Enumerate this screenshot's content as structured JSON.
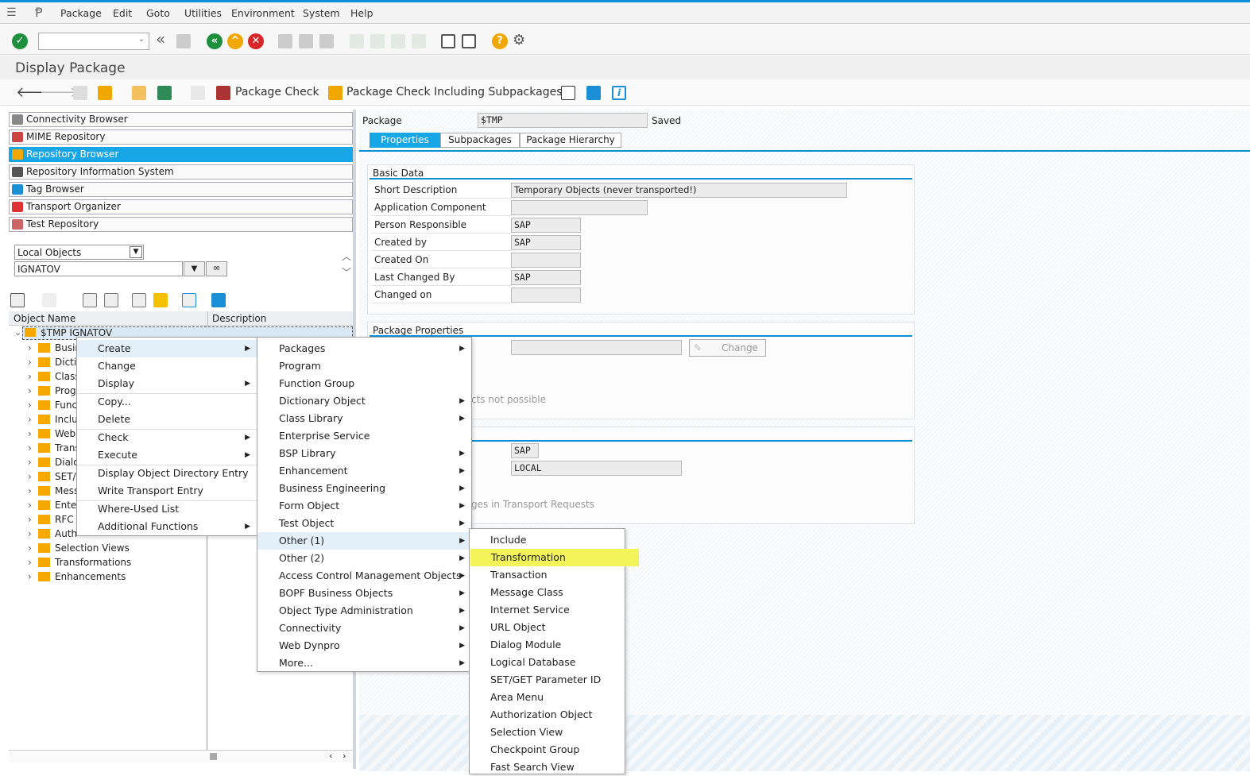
{
  "menubar": {
    "items": [
      "Package",
      "Edit",
      "Goto",
      "Utilities",
      "Environment",
      "System",
      "Help"
    ]
  },
  "header": {
    "title": "Display Package"
  },
  "app_toolbar": {
    "package_check": "Package Check",
    "package_check_sub": "Package Check Including Subpackages"
  },
  "navigator": {
    "buttons": [
      "Connectivity Browser",
      "MIME Repository",
      "Repository Browser",
      "Repository Information System",
      "Tag Browser",
      "Transport Organizer",
      "Test Repository"
    ],
    "selected": 2
  },
  "object_select": {
    "type": "Local Objects",
    "value": "IGNATOV"
  },
  "tree": {
    "col_name": "Object Name",
    "col_desc": "Description",
    "root": "$TMP IGNATOV",
    "items": [
      "Busin",
      "Dictio",
      "Class",
      "Progr",
      "Funct",
      "Inclu",
      "Web",
      "Trans",
      "Dialo",
      "SET/",
      "Mess",
      "Enter",
      "RFC S",
      "Auth",
      "Selection Views",
      "Transformations",
      "Enhancements"
    ]
  },
  "package": {
    "label": "Package",
    "value": "$TMP",
    "status": "Saved"
  },
  "tabs": [
    "Properties",
    "Subpackages",
    "Package Hierarchy"
  ],
  "basic_data": {
    "title": "Basic Data",
    "rows": [
      {
        "label": "Short Description",
        "value": "Temporary Objects (never transported!)"
      },
      {
        "label": "Application Component",
        "value": ""
      },
      {
        "label": "Person Responsible",
        "value": "SAP"
      },
      {
        "label": "Created by",
        "value": "SAP"
      },
      {
        "label": "Created On",
        "value": ""
      },
      {
        "label": "Last Changed By",
        "value": "SAP"
      },
      {
        "label": "Changed on",
        "value": ""
      }
    ]
  },
  "package_properties": {
    "title": "Package Properties",
    "change_button": "Change",
    "partial_text": "cts not possible"
  },
  "transport": {
    "software_component": "SAP",
    "transport_layer": "LOCAL",
    "partial_text": "ges in Transport Requests"
  },
  "context_menu": {
    "items": [
      {
        "label": "Create",
        "sub": true,
        "hl": true
      },
      {
        "label": "Change"
      },
      {
        "label": "Display",
        "sub": true
      },
      {
        "label": "Copy...",
        "sep": true
      },
      {
        "label": "Delete"
      },
      {
        "label": "Check",
        "sub": true,
        "sep": true
      },
      {
        "label": "Execute",
        "sub": true
      },
      {
        "label": "Display Object Directory Entry",
        "sep": true
      },
      {
        "label": "Write Transport Entry"
      },
      {
        "label": "Where-Used List",
        "sep": true
      },
      {
        "label": "Additional Functions",
        "sub": true
      }
    ]
  },
  "create_menu": {
    "items": [
      {
        "label": "Packages",
        "sub": true
      },
      {
        "label": "Program"
      },
      {
        "label": "Function Group"
      },
      {
        "label": "Dictionary Object",
        "sub": true
      },
      {
        "label": "Class Library",
        "sub": true
      },
      {
        "label": "Enterprise Service"
      },
      {
        "label": "BSP Library",
        "sub": true
      },
      {
        "label": "Enhancement",
        "sub": true
      },
      {
        "label": "Business Engineering",
        "sub": true
      },
      {
        "label": "Form Object",
        "sub": true
      },
      {
        "label": "Test Object",
        "sub": true
      },
      {
        "label": "Other (1)",
        "sub": true,
        "hl": true
      },
      {
        "label": "Other (2)",
        "sub": true
      },
      {
        "label": "Access Control Management Objects",
        "sub": true
      },
      {
        "label": "BOPF Business Objects",
        "sub": true
      },
      {
        "label": "Object Type Administration",
        "sub": true
      },
      {
        "label": "Connectivity",
        "sub": true
      },
      {
        "label": "Web Dynpro",
        "sub": true
      },
      {
        "label": "More...",
        "sub": true
      }
    ]
  },
  "other1_menu": {
    "items": [
      {
        "label": "Include"
      },
      {
        "label": "Transformation",
        "yl": true
      },
      {
        "label": "Transaction"
      },
      {
        "label": "Message Class"
      },
      {
        "label": "Internet Service"
      },
      {
        "label": "URL Object"
      },
      {
        "label": "Dialog Module"
      },
      {
        "label": "Logical Database"
      },
      {
        "label": "SET/GET Parameter ID"
      },
      {
        "label": "Area Menu"
      },
      {
        "label": "Authorization Object"
      },
      {
        "label": "Selection View"
      },
      {
        "label": "Checkpoint Group"
      },
      {
        "label": "Fast Search View"
      }
    ]
  },
  "colors": {
    "accent": "#0a8fd6",
    "selected": "#17a6e6",
    "highlight": "#f3f35a",
    "folder": "#f5a800"
  }
}
